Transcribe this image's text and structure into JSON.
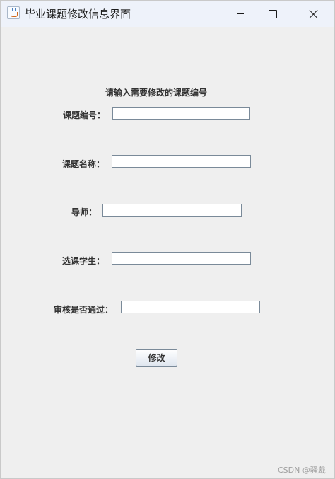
{
  "window": {
    "title": "毕业课题修改信息界面"
  },
  "form": {
    "prompt": "请输入需要修改的课题编号",
    "fields": [
      {
        "label": "课题编号：",
        "value": ""
      },
      {
        "label": "课题名称：",
        "value": ""
      },
      {
        "label": "导师：",
        "value": ""
      },
      {
        "label": "选课学生：",
        "value": ""
      },
      {
        "label": "审核是否通过：",
        "value": ""
      }
    ],
    "submit_label": "修改"
  },
  "watermark": "CSDN @骚戴"
}
